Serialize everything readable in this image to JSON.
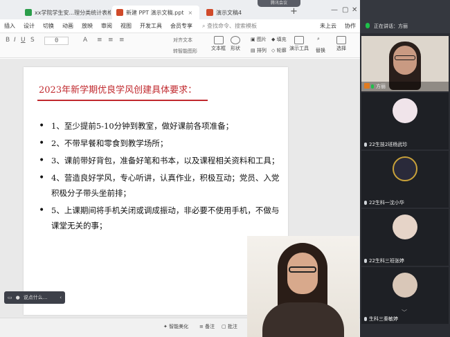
{
  "tabs": [
    {
      "label": "xx学院学生安...理分类统计表格",
      "color": "#2a9d4a"
    },
    {
      "label": "新建 PPT 演示文稿.ppt",
      "color": "#d04a2a"
    },
    {
      "label": "演示文稿4",
      "color": "#d04a2a"
    }
  ],
  "meeting_pill": "腾讯会议",
  "menu": [
    "插入",
    "设计",
    "切换",
    "动画",
    "放映",
    "审阅",
    "视图",
    "开发工具",
    "会员专享"
  ],
  "search_placeholder": "查找命令、搜索模板",
  "cloud_label": "未上云",
  "collab_label": "协作",
  "toolbar": {
    "textbox": "文本框",
    "shape": "形状",
    "arrange": "排列",
    "picture": "图片",
    "fill": "填充",
    "outline": "轮廓",
    "presenter_tools": "演示工具",
    "replace": "替换",
    "select": "选择",
    "smart_art": "转智能图形",
    "text_fx": "对齐文本",
    "font_size": "0"
  },
  "slide": {
    "title": "2023年新学期优良学风创建具体要求：",
    "bullets": [
      "1、至少提前5-10分钟到教室，做好课前各项准备；",
      "2、不带早餐和零食到教学场所；",
      "3、课前带好背包，准备好笔和书本，以及课程相关资料和工具；",
      "4、营造良好学风，专心听讲，认真作业，积极互动；党员、入党积极分子带头坐前排；",
      "5、上课期间将手机关闭或调成振动，非必要不使用手机，不做与课堂无关的事；"
    ]
  },
  "speech_hint": "说点什么...",
  "status": {
    "beautify": "智能美化",
    "notes": "备注",
    "comment": "批注"
  },
  "panel": {
    "speaking": "正在讲话：方丽",
    "participants": [
      {
        "name": "方丽",
        "avatar_color": "#b89a85"
      },
      {
        "name": "22生技2班杨武珍",
        "avatar_color": "#f0e4ea"
      },
      {
        "name": "22生科一沈小华",
        "avatar_color": "#2a2a3a"
      },
      {
        "name": "22生科三班张婷",
        "avatar_color": "#e6d4c8"
      },
      {
        "name": "生科三秦敏婷",
        "avatar_color": "#d9c7b8"
      }
    ]
  },
  "colors": {
    "accent": "#c0282d",
    "mic_active": "#1ec04a"
  }
}
